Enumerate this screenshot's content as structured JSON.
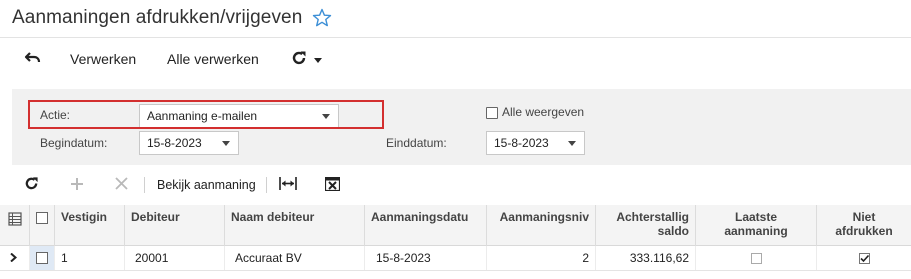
{
  "page": {
    "title": "Aanmaningen afdrukken/vrijgeven"
  },
  "toolbar": {
    "undo_icon": "undo-icon",
    "process_label": "Verwerken",
    "process_all_label": "Alle verwerken",
    "refresh_icon": "refresh-icon"
  },
  "filter": {
    "action_label": "Actie:",
    "action_value": "Aanmaning e-mailen",
    "show_all_label": "Alle weergeven",
    "show_all_checked": false,
    "start_date_label": "Begindatum:",
    "start_date_value": "15-8-2023",
    "end_date_label": "Einddatum:",
    "end_date_value": "15-8-2023"
  },
  "grid_toolbar": {
    "view_dunning_label": "Bekijk aanmaning"
  },
  "grid": {
    "columns": [
      "Vestigin",
      "Debiteur",
      "Naam debiteur",
      "Aanmaningsdatu",
      "Aanmaningsniv",
      "Achterstallig saldo",
      "Laatste aanmaning",
      "Niet afdrukken"
    ],
    "rows": [
      {
        "branch": "1",
        "customer": "20001",
        "customer_name": "Accuraat BV",
        "dunning_date": "15-8-2023",
        "dunning_level": "2",
        "overdue_balance": "333.116,62",
        "last_dunning": false,
        "do_not_print": true
      }
    ]
  },
  "colors": {
    "highlight_border": "#d32f2f",
    "star": "#3d8fd6",
    "filter_bg": "#f1f1f1",
    "selected_cell": "#dfe9f5"
  }
}
